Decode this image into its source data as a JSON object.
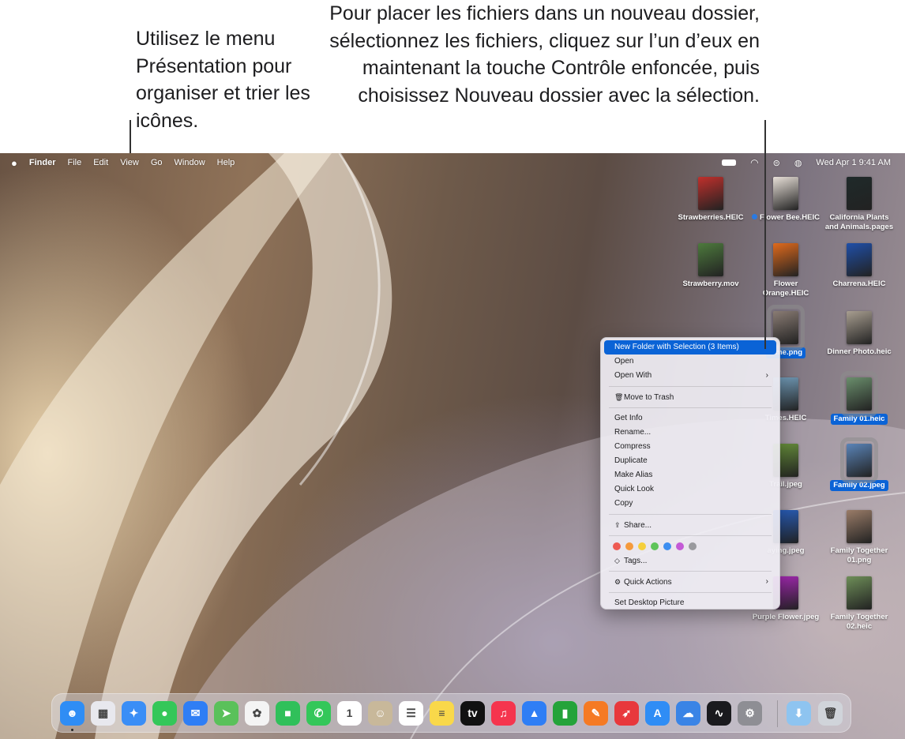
{
  "callouts": {
    "left": "Utilisez le menu Présentation pour organiser et trier les icônes.",
    "right": "Pour placer les fichiers dans un nouveau dossier, sélectionnez les fichiers, cliquez sur l’un d’eux en maintenant la touche Contrôle enfoncée, puis choisissez Nouveau dossier avec la sélection."
  },
  "menubar": {
    "apple": "",
    "app_name": "Finder",
    "items": [
      "File",
      "Edit",
      "View",
      "Go",
      "Window",
      "Help"
    ],
    "datetime": "Wed Apr 1  9:41 AM",
    "status_icons": [
      "battery-icon",
      "wifi-icon",
      "control-center-icon",
      "siri-icon"
    ]
  },
  "desktop_icons": [
    {
      "label": "Strawberries.HEIC",
      "color": "#c0302c"
    },
    {
      "label": "Flower Bee.HEIC",
      "color": "#e8e0d8",
      "tag": "#2a7ae2"
    },
    {
      "label": "California Plants and Animals.pages",
      "color": "#1f2a2a"
    },
    {
      "label": "Strawberry.mov",
      "color": "#4d7a3d"
    },
    {
      "label": "Flower Orange.HEIC",
      "color": "#e06a1c"
    },
    {
      "label": "Charrena.HEIC",
      "color": "#1f4fa8"
    },
    {
      "label": "Time.png",
      "color": "#8a7c74",
      "selected": true
    },
    {
      "label": "Dinner Photo.heic",
      "color": "#a89e90"
    },
    {
      "label": "Times.HEIC",
      "color": "#7aa8c8"
    },
    {
      "label": "Family 01.heic",
      "color": "#6a8e6c",
      "selected": true
    },
    {
      "label": "Trail.jpeg",
      "color": "#6e9a3e"
    },
    {
      "label": "Family 02.jpeg",
      "color": "#5a84b8",
      "selected": true
    },
    {
      "label": "aying.jpeg",
      "color": "#2a64c8"
    },
    {
      "label": "Family Together 01.png",
      "color": "#9a7c68"
    },
    {
      "label": "Purple Flower.jpeg",
      "color": "#b02ac0"
    },
    {
      "label": "Family Together 02.heic",
      "color": "#6e8e58"
    }
  ],
  "context_menu": {
    "highlighted": "New Folder with Selection (3 Items)",
    "open": "Open",
    "open_with": "Open With",
    "trash": "Move to Trash",
    "get_info": "Get Info",
    "rename": "Rename...",
    "compress": "Compress",
    "duplicate": "Duplicate",
    "make_alias": "Make Alias",
    "quick_look": "Quick Look",
    "copy": "Copy",
    "share": "Share...",
    "tag_colors": [
      "#ee5a52",
      "#f59a3c",
      "#f5cf3c",
      "#5fc45a",
      "#3d8ef0",
      "#c45ad6",
      "#9a9a9e"
    ],
    "tags": "Tags...",
    "quick_actions": "Quick Actions",
    "set_desktop": "Set Desktop Picture"
  },
  "dock": {
    "apps": [
      {
        "name": "Finder",
        "icon": "finder-icon",
        "color": "#2f8df5",
        "glyph": "☻"
      },
      {
        "name": "Launchpad",
        "icon": "launchpad-icon",
        "color": "#e8e8ee",
        "glyph": "▦"
      },
      {
        "name": "Safari",
        "icon": "safari-icon",
        "color": "#3a8ef6",
        "glyph": "✦"
      },
      {
        "name": "Messages",
        "icon": "messages-icon",
        "color": "#34c759",
        "glyph": "●"
      },
      {
        "name": "Mail",
        "icon": "mail-icon",
        "color": "#2f7ef5",
        "glyph": "✉"
      },
      {
        "name": "Maps",
        "icon": "maps-icon",
        "color": "#5ac15a",
        "glyph": "➤"
      },
      {
        "name": "Photos",
        "icon": "photos-icon",
        "color": "#f4f4f4",
        "glyph": "✿"
      },
      {
        "name": "FaceTime",
        "icon": "facetime-icon",
        "color": "#30c05a",
        "glyph": "■"
      },
      {
        "name": "Phone",
        "icon": "phone-icon",
        "color": "#34c759",
        "glyph": "✆"
      },
      {
        "name": "Calendar",
        "icon": "calendar-icon",
        "color": "#ffffff",
        "glyph": "1"
      },
      {
        "name": "Contacts",
        "icon": "contacts-icon",
        "color": "#c8b89a",
        "glyph": "☺"
      },
      {
        "name": "Reminders",
        "icon": "reminders-icon",
        "color": "#ffffff",
        "glyph": "☰"
      },
      {
        "name": "Notes",
        "icon": "notes-icon",
        "color": "#f9d84a",
        "glyph": "≡"
      },
      {
        "name": "TV",
        "icon": "tv-icon",
        "color": "#111111",
        "glyph": "tv"
      },
      {
        "name": "Music",
        "icon": "music-icon",
        "color": "#f5354e",
        "glyph": "♫"
      },
      {
        "name": "Keynote",
        "icon": "keynote-icon",
        "color": "#2f7ef5",
        "glyph": "▲"
      },
      {
        "name": "Numbers",
        "icon": "numbers-icon",
        "color": "#24a33a",
        "glyph": "▮"
      },
      {
        "name": "Pages",
        "icon": "pages-icon",
        "color": "#f57a24",
        "glyph": "✎"
      },
      {
        "name": "Rocket",
        "icon": "rocket-icon",
        "color": "#e8383c",
        "glyph": "➶"
      },
      {
        "name": "App Store",
        "icon": "app-store-icon",
        "color": "#2f8df5",
        "glyph": "A"
      },
      {
        "name": "Weather",
        "icon": "weather-icon",
        "color": "#3a84e6",
        "glyph": "☁"
      },
      {
        "name": "Activity Monitor",
        "icon": "activity-monitor-icon",
        "color": "#1a1a1e",
        "glyph": "∿"
      },
      {
        "name": "System Settings",
        "icon": "settings-icon",
        "color": "#8e8e94",
        "glyph": "⚙"
      },
      {
        "name": "Downloads",
        "icon": "downloads-folder-icon",
        "color": "#8ec4f0",
        "glyph": "⬇"
      },
      {
        "name": "Trash",
        "icon": "trash-icon",
        "color": "#d0d4da",
        "glyph": "🗑"
      }
    ]
  }
}
